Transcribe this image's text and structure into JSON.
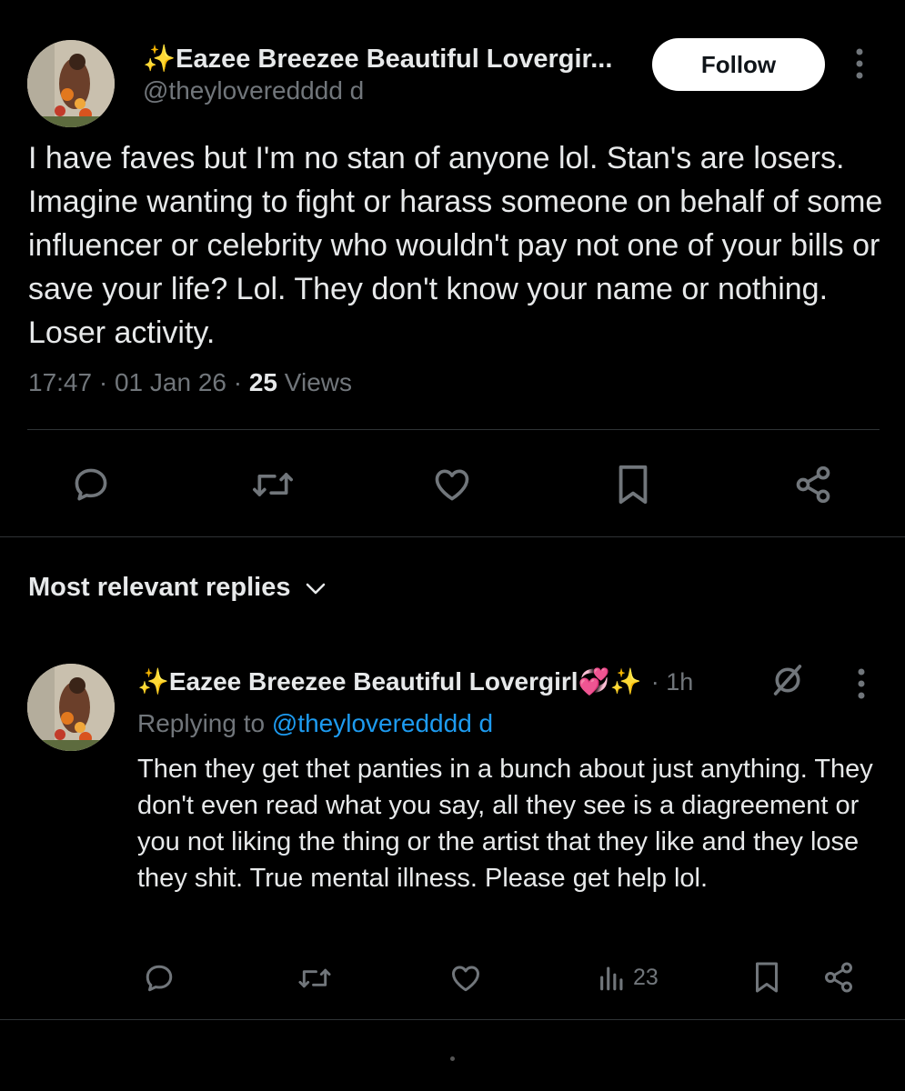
{
  "post": {
    "author_name": "✨Eazee Breezee Beautiful Lovergir...",
    "author_handle": "@theyloveredddd d",
    "follow_label": "Follow",
    "text": "I have faves but I'm no stan of anyone lol. Stan's are losers. Imagine wanting to fight or harass someone on behalf of some influencer or celebrity who wouldn't pay not one of your bills or save your life? Lol. They don't know your name or nothing. Loser activity.",
    "time": "17:47",
    "date": "01 Jan 26",
    "views_count": "25",
    "views_label": "Views",
    "separator": "·"
  },
  "replies_section": {
    "title": "Most relevant replies"
  },
  "reply": {
    "author_name": "✨Eazee Breezee Beautiful Lovergirl💞✨",
    "age": "· 1h",
    "replying_prefix": "Replying to",
    "replying_handle": "@theyloveredddd d",
    "text": "Then they get thet panties in a bunch about just anything. They don't even read what you say, all they see is a diagreement or you not liking the thing or the artist that they like and they lose they shit. True mental illness. Please get help lol.",
    "views_count": "23"
  },
  "icons": {
    "reply": "reply-icon",
    "repost": "repost-icon",
    "like": "like-icon",
    "bookmark": "bookmark-icon",
    "share": "share-icon",
    "views": "views-icon",
    "grok": "grok-icon",
    "more": "more-icon",
    "chevron": "chevron-down-icon"
  },
  "colors": {
    "background": "#000000",
    "text": "#e7e9ea",
    "secondary": "#71767b",
    "link": "#1d9bf0",
    "divider": "#2f3336"
  }
}
